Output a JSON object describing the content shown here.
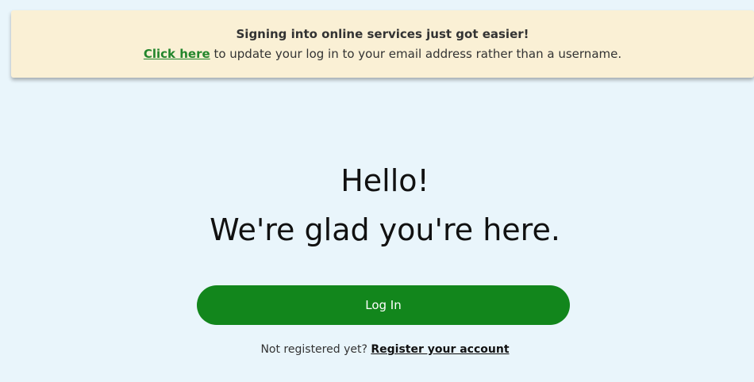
{
  "banner": {
    "title": "Signing into online services just got easier!",
    "link_label": "Click here",
    "message": " to update your log in to your email address rather than a username."
  },
  "hero": {
    "greeting": "Hello!",
    "subtitle": "We're glad you're here."
  },
  "login": {
    "button_label": "Log In"
  },
  "register": {
    "prompt": "Not registered yet? ",
    "link_label": "Register your account"
  },
  "colors": {
    "background": "#e9f5fb",
    "banner_background": "#faf0d5",
    "primary_green": "#12861c",
    "link_green": "#23862c"
  }
}
